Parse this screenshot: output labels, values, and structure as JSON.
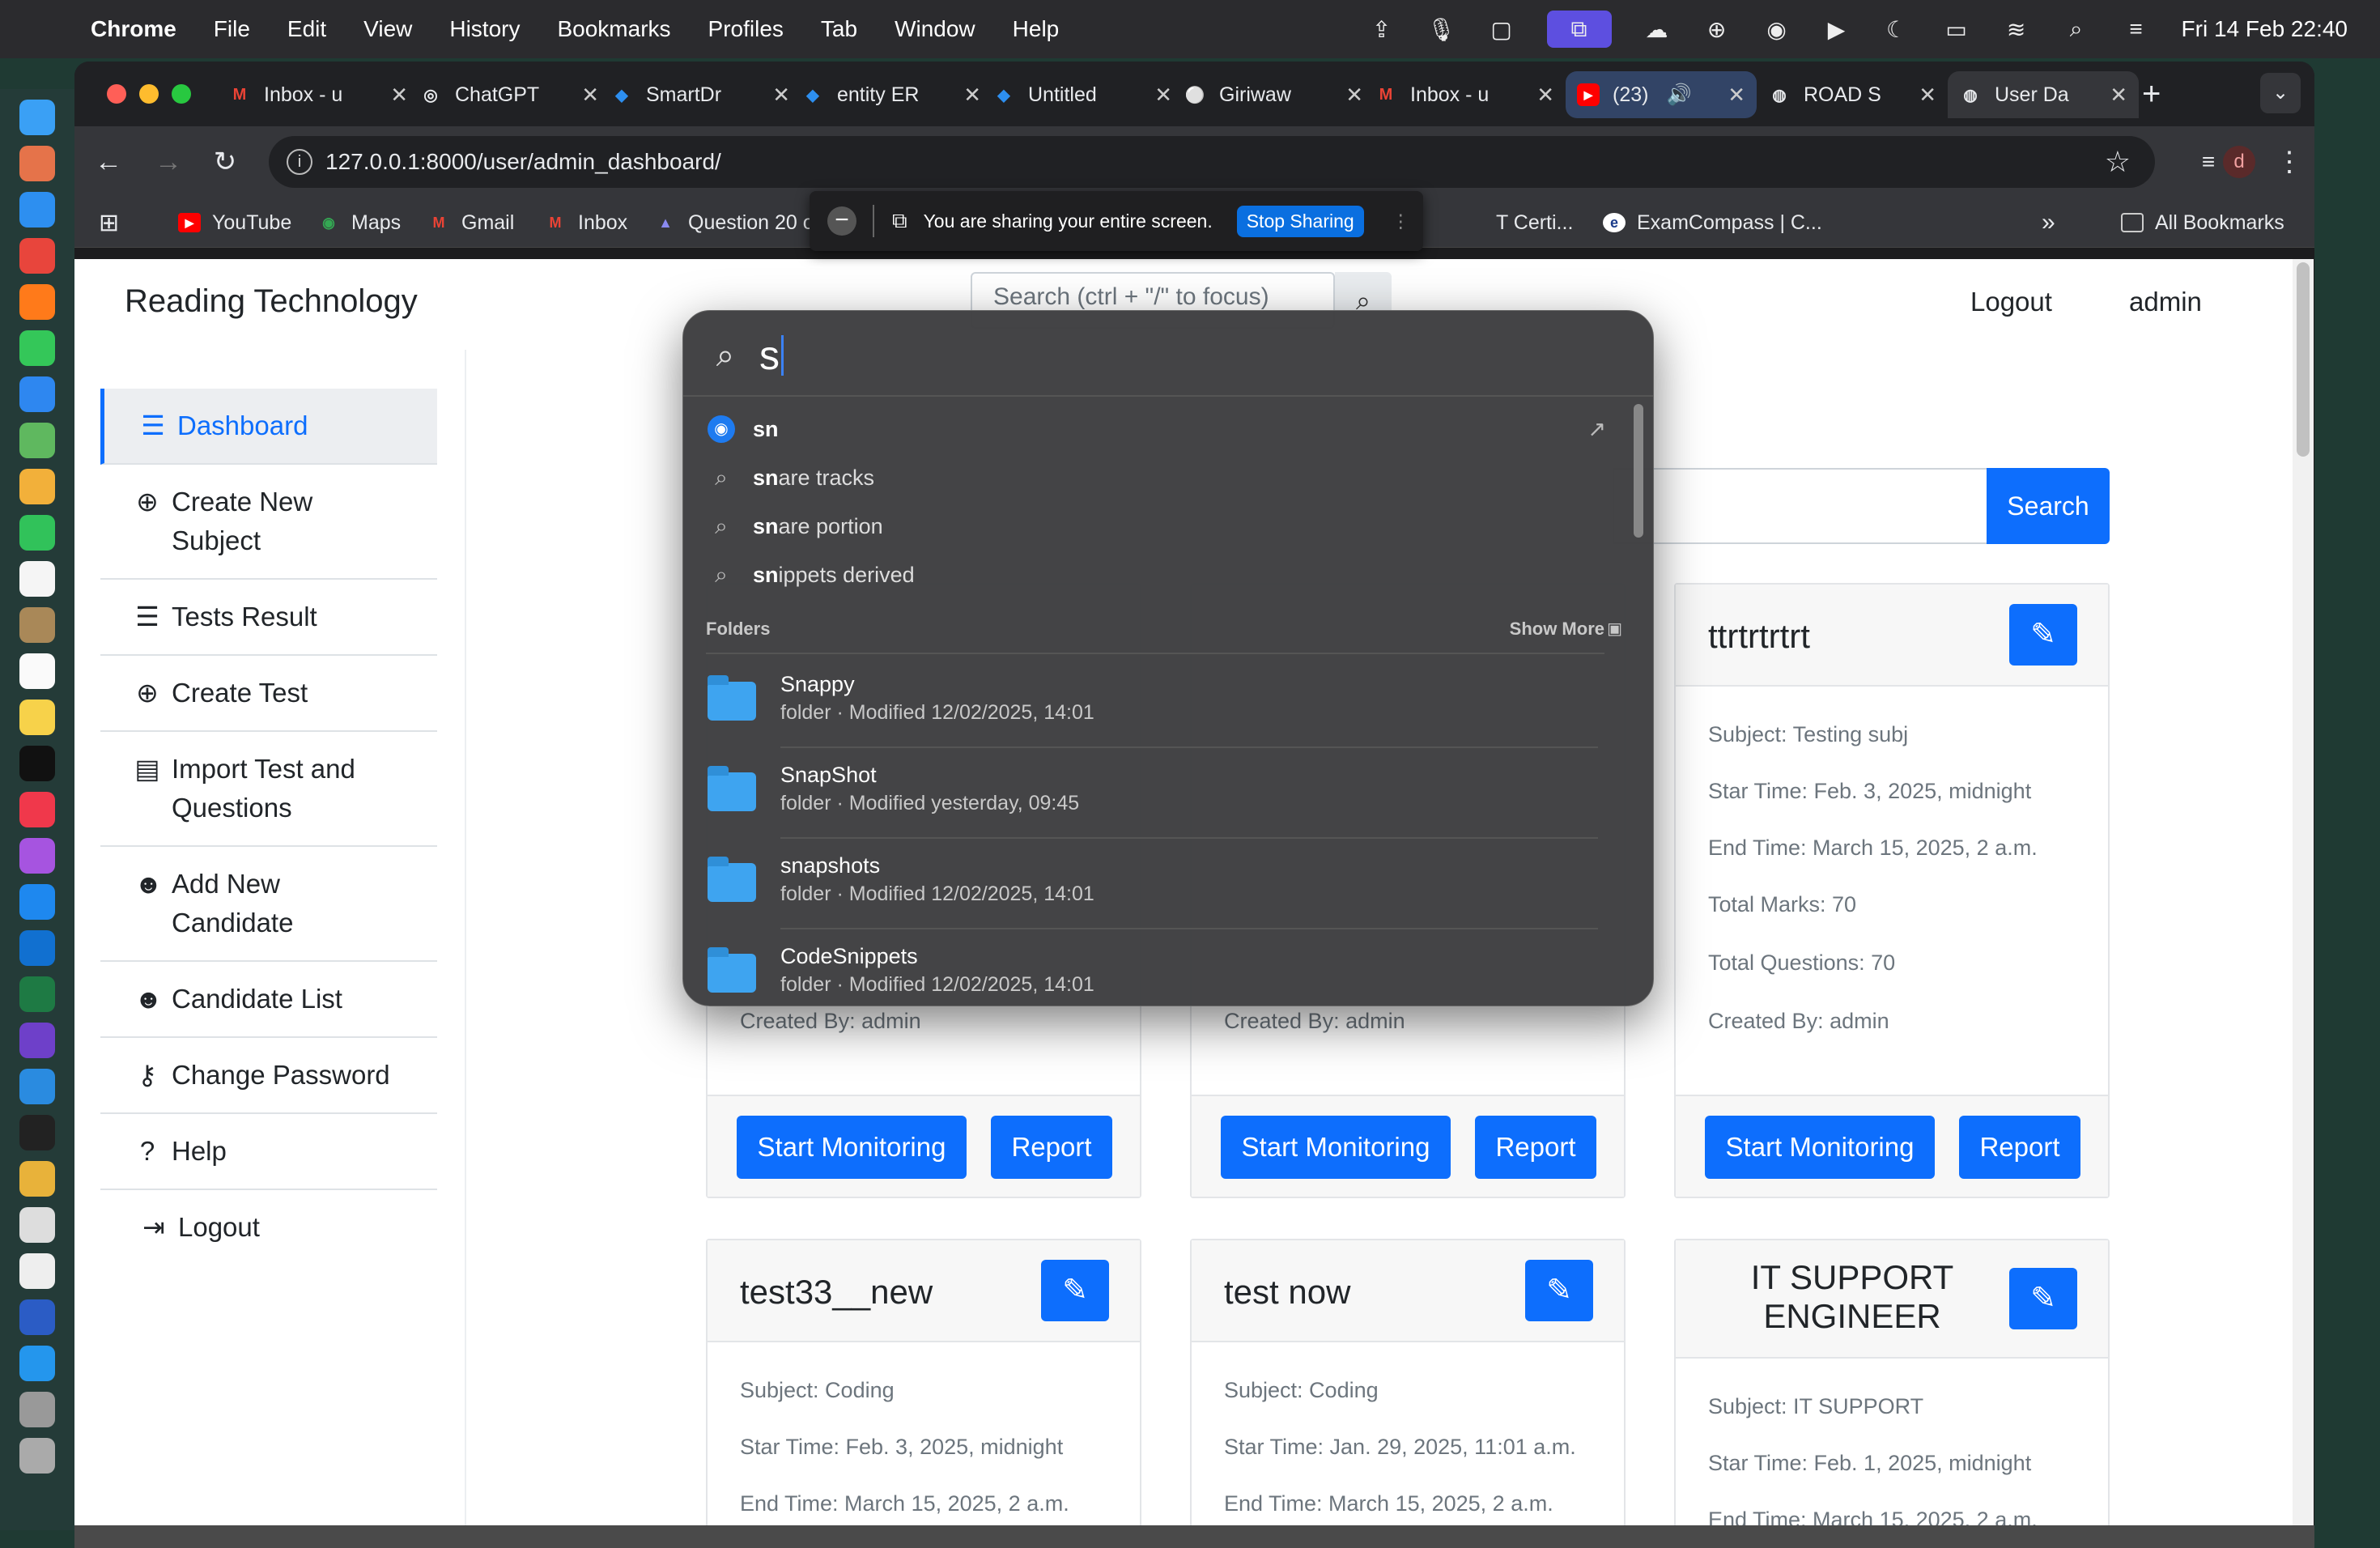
{
  "menubar": {
    "items": [
      "Chrome",
      "File",
      "Edit",
      "View",
      "History",
      "Bookmarks",
      "Profiles",
      "Tab",
      "Window",
      "Help"
    ],
    "datetime": "Fri 14 Feb  22:40"
  },
  "tabs": [
    {
      "label": "Inbox - u",
      "fav": "M"
    },
    {
      "label": "ChatGPT",
      "fav": "◎"
    },
    {
      "label": "SmartDr",
      "fav": "◆"
    },
    {
      "label": "entity ER",
      "fav": "◆"
    },
    {
      "label": "Untitled",
      "fav": "◆"
    },
    {
      "label": "Giriwaw",
      "fav": "⚪"
    },
    {
      "label": "Inbox - u",
      "fav": "M"
    },
    {
      "label": "(23)",
      "fav": "▶"
    },
    {
      "label": "ROAD S",
      "fav": "◍"
    },
    {
      "label": "User Da",
      "fav": "◍"
    }
  ],
  "url": "127.0.0.1:8000/user/admin_dashboard/",
  "profile_initial": "d",
  "bookmarks": [
    {
      "label": "YouTube",
      "fav": "▶"
    },
    {
      "label": "Maps",
      "fav": "◉"
    },
    {
      "label": "Gmail",
      "fav": "M"
    },
    {
      "label": "Inbox",
      "fav": "M"
    },
    {
      "label": "Question 20 of the...",
      "fav": "▲"
    },
    {
      "label": "T Certi...",
      "fav": ""
    },
    {
      "label": "ExamCompass | C...",
      "fav": "e"
    }
  ],
  "all_bookmarks": "All Bookmarks",
  "share_bar": {
    "text": "You are sharing your entire screen.",
    "stop": "Stop Sharing"
  },
  "site": {
    "brand": "Reading Technology",
    "search_placeholder": "Search (ctrl + \"/\" to focus)",
    "logout": "Logout",
    "user": "admin",
    "search_button": "Search"
  },
  "sidebar": [
    {
      "label": "Dashboard",
      "icon": "list-icon"
    },
    {
      "label": "Create New Subject",
      "icon": "plus-circle-icon"
    },
    {
      "label": "Tests Result",
      "icon": "list-icon"
    },
    {
      "label": "Create Test",
      "icon": "plus-circle-icon"
    },
    {
      "label": "Import Test and Questions",
      "icon": "file-import-icon"
    },
    {
      "label": "Add New Candidate",
      "icon": "user-plus-icon"
    },
    {
      "label": "Candidate List",
      "icon": "users-icon"
    },
    {
      "label": "Change Password",
      "icon": "key-icon"
    },
    {
      "label": "Help",
      "icon": "question-icon"
    },
    {
      "label": "Logout",
      "icon": "sign-out-icon"
    }
  ],
  "cards_row1": [
    {
      "created": "Created By: admin",
      "start": "Start Monitoring",
      "report": "Report"
    },
    {
      "created": "Created By: admin",
      "start": "Start Monitoring",
      "report": "Report"
    },
    {
      "title": "ttrtrtrtrt",
      "subject": "Subject: Testing subj",
      "start_time": "Star Time: Feb. 3, 2025, midnight",
      "end_time": "End Time: March 15, 2025, 2 a.m.",
      "marks": "Total Marks: 70",
      "questions": "Total Questions: 70",
      "created": "Created By: admin",
      "start": "Start Monitoring",
      "report": "Report"
    }
  ],
  "cards_row2": [
    {
      "title": "test33__new",
      "subject": "Subject: Coding",
      "start_time": "Star Time: Feb. 3, 2025, midnight",
      "end_time": "End Time: March 15, 2025, 2 a.m."
    },
    {
      "title": "test now",
      "subject": "Subject: Coding",
      "start_time": "Star Time: Jan. 29, 2025, 11:01 a.m.",
      "end_time": "End Time: March 15, 2025, 2 a.m."
    },
    {
      "title": "IT SUPPORT ENGINEER",
      "subject": "Subject: IT SUPPORT",
      "start_time": "Star Time: Feb. 1, 2025, midnight",
      "end_time": "End Time: March 15, 2025, 2 a.m."
    }
  ],
  "spotlight": {
    "query": "s",
    "suggestions": [
      {
        "bold": "sn",
        "rest": ""
      },
      {
        "bold": "sn",
        "rest": "are tracks"
      },
      {
        "bold": "sn",
        "rest": "are portion"
      },
      {
        "bold": "sn",
        "rest": "ippets derived"
      }
    ],
    "folders_header": "Folders",
    "show_more": "Show More",
    "folders": [
      {
        "name": "Snappy",
        "detail": "folder · Modified 12/02/2025, 14:01"
      },
      {
        "name": "SnapShot",
        "detail": "folder · Modified yesterday, 09:45"
      },
      {
        "name": "snapshots",
        "detail": "folder · Modified 12/02/2025, 14:01"
      },
      {
        "name": "CodeSnippets",
        "detail": "folder · Modified 12/02/2025, 14:01"
      }
    ]
  }
}
